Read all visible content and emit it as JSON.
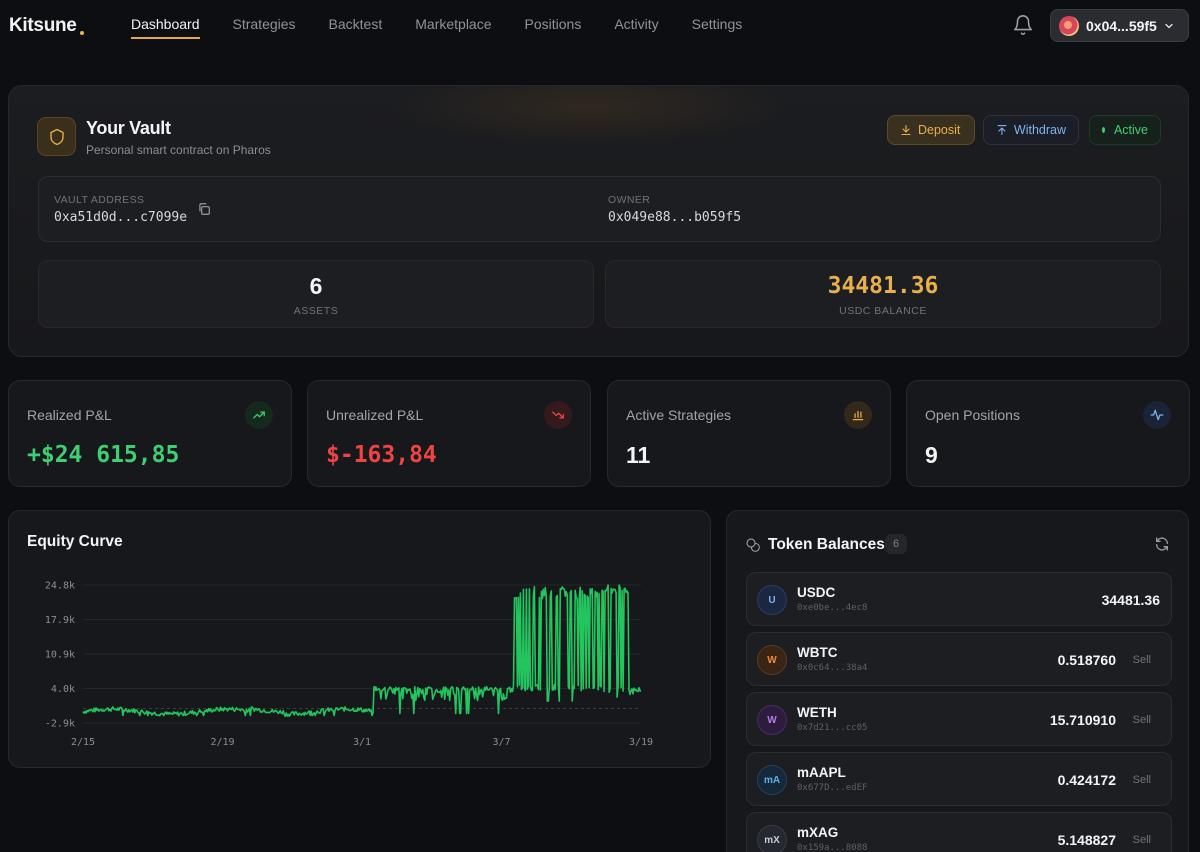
{
  "nav": {
    "brand": "Kitsune",
    "links": [
      "Dashboard",
      "Strategies",
      "Backtest",
      "Marketplace",
      "Positions",
      "Activity",
      "Settings"
    ],
    "active": "Dashboard",
    "wallet": "0x04...59f5"
  },
  "vault": {
    "title": "Your Vault",
    "subtitle": "Personal smart contract on Pharos",
    "deposit_label": "Deposit",
    "withdraw_label": "Withdraw",
    "status": "Active",
    "address_label": "VAULT ADDRESS",
    "address": "0xa51d0d...c7099e",
    "owner_label": "OWNER",
    "owner": "0x049e88...b059f5",
    "assets_value": "6",
    "assets_label": "ASSETS",
    "usdc_value": "34481.36",
    "usdc_label": "USDC BALANCE"
  },
  "metrics": [
    {
      "label": "Realized P&L",
      "value": "+$24 615,85",
      "color": "#3fcf72",
      "icon": "trending-up-icon"
    },
    {
      "label": "Unrealized P&L",
      "value": "$-163,84",
      "color": "#ef4444",
      "icon": "trending-down-icon"
    },
    {
      "label": "Active Strategies",
      "value": "11",
      "color": "#f3f4f6",
      "icon": "bar-chart-icon"
    },
    {
      "label": "Open Positions",
      "value": "9",
      "color": "#f3f4f6",
      "icon": "activity-icon"
    }
  ],
  "equity": {
    "title": "Equity Curve",
    "chart_data": {
      "type": "area",
      "y_ticks": [
        "24.8k",
        "17.9k",
        "10.9k",
        "4.0k",
        "-2.9k"
      ],
      "x_ticks": [
        "2/15",
        "2/19",
        "3/1",
        "3/7",
        "3/19"
      ],
      "ylim": [
        -2900,
        24800
      ],
      "series": [
        {
          "x": [
            0,
            0.17,
            0.34,
            0.52,
            0.53,
            0.76,
            0.77,
            0.92,
            1.0
          ],
          "low": [
            -500,
            -800,
            -300,
            -1000,
            1500,
            3500,
            4000,
            2000,
            3000
          ],
          "high": [
            -500,
            -800,
            -300,
            -1000,
            4200,
            4500,
            23500,
            24800,
            3500
          ]
        }
      ]
    }
  },
  "tokens": {
    "title": "Token Balances",
    "count": "6",
    "items": [
      {
        "avatar": "U",
        "symbol": "USDC",
        "address": "0xe0be...4ec8",
        "balance": "34481.36",
        "sell": "",
        "bg": "#1b2740",
        "fg": "#7fb2ee",
        "border": "#2c3f63"
      },
      {
        "avatar": "W",
        "symbol": "WBTC",
        "address": "0x0c64...38a4",
        "balance": "0.518760",
        "sell": "Sell",
        "bg": "#3a2415",
        "fg": "#f08a3c",
        "border": "#5c3a20"
      },
      {
        "avatar": "W",
        "symbol": "WETH",
        "address": "0x7d21...cc05",
        "balance": "15.710910",
        "sell": "Sell",
        "bg": "#2d1c3d",
        "fg": "#b07fe8",
        "border": "#4a2d63"
      },
      {
        "avatar": "mA",
        "symbol": "mAAPL",
        "address": "0x677D...edEF",
        "balance": "0.424172",
        "sell": "Sell",
        "bg": "#15293a",
        "fg": "#5fb0e6",
        "border": "#23415c"
      },
      {
        "avatar": "mX",
        "symbol": "mXAG",
        "address": "0x159a...8088",
        "balance": "5.148827",
        "sell": "Sell",
        "bg": "#262830",
        "fg": "#c9ccd3",
        "border": "#3a3d47"
      }
    ]
  }
}
